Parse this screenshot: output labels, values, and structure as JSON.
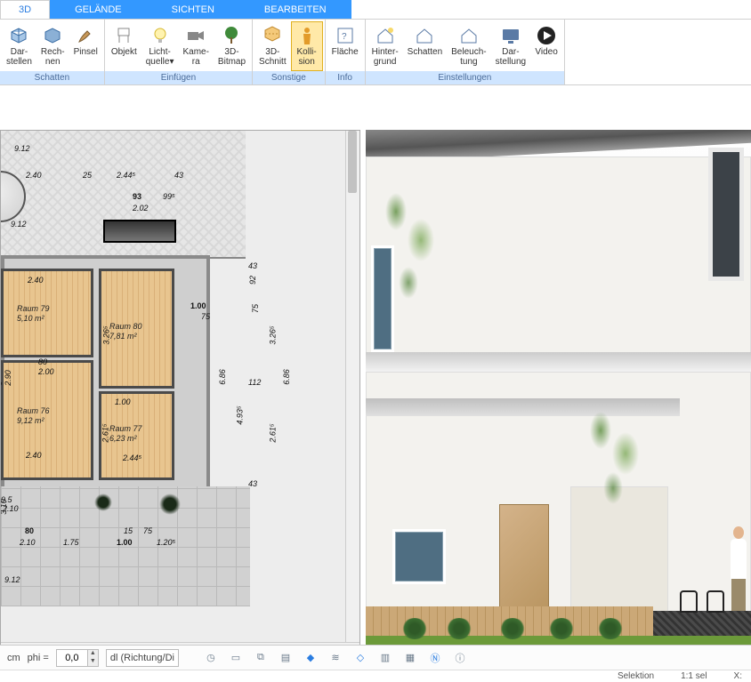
{
  "tabs": {
    "t1": "3D",
    "t2": "GELÄNDE",
    "t3": "SICHTEN",
    "t4": "BEARBEITEN"
  },
  "ribbon": {
    "groups": {
      "schatten": "Schatten",
      "einfuegen": "Einfügen",
      "sonstige": "Sonstige",
      "info": "Info",
      "einstellungen": "Einstellungen"
    },
    "darstellen": "Dar-\nstellen",
    "rechnen": "Rech-\nnen",
    "pinsel": "Pinsel",
    "objekt": "Objekt",
    "licht": "Licht-\nquelle▾",
    "kamera": "Kame-\nra",
    "bitmap": "3D-\nBitmap",
    "schnitt": "3D-\nSchnitt",
    "kollision": "Kolli-\nsion",
    "flaeche": "Fläche",
    "hintergrund": "Hinter-\ngrund",
    "schatten2": "Schatten",
    "beleuchtung": "Beleuch-\ntung",
    "darstellung": "Dar-\nstellung",
    "video": "Video"
  },
  "plan": {
    "d_9_12a": "9.12",
    "d_2_40a": "2.40",
    "d_25": "25",
    "d_2_445": "2.44⁵",
    "d_43a": "43",
    "d_93": "93",
    "d_995": "99⁵",
    "d_2_02": "2.02",
    "d_9_12b": "9.12",
    "d_43b": "43",
    "d_92": "92",
    "d_1_00": "1.00",
    "d_75r": "75",
    "d_112": "112",
    "d_43c": "43",
    "d_3_265": "3.26⁵",
    "d_6_86": "6.86",
    "d_4_935": "4.93⁵",
    "d_2_615": "2.61⁵",
    "d_2_40b": "2.40",
    "d_6_290": "6\n2.90",
    "d_80a": "80",
    "d_2_00": "2.00",
    "d_2_40c": "2.40",
    "d_2_615b": "2.61⁵",
    "d_3_10": "3.10",
    "d_100": "1.00",
    "d_2_44": "2.44⁵",
    "d_9_5": "9.5",
    "d_2_10": "2.10",
    "d_80b": "80",
    "d_1_75": "1.75",
    "d_1_00b": "1.00",
    "d_1_205": "1.20⁵",
    "d_15": "15",
    "d_75": "75",
    "d_9_12c": "9.12",
    "r79_name": "Raum 79",
    "r79_area": "5,10 m²",
    "r80_name": "Raum 80",
    "r80_area": "7,81 m²",
    "r76_name": "Raum 76",
    "r76_area": "9,12 m²",
    "r77_name": "Raum 77",
    "r77_area": "6,23 m²"
  },
  "status": {
    "unit": "cm",
    "phi_label": "phi =",
    "phi_val": "0,0",
    "dl": "dl (Richtung/Di",
    "selektion": "Selektion",
    "sel": "1:1 sel",
    "x": "X:"
  }
}
